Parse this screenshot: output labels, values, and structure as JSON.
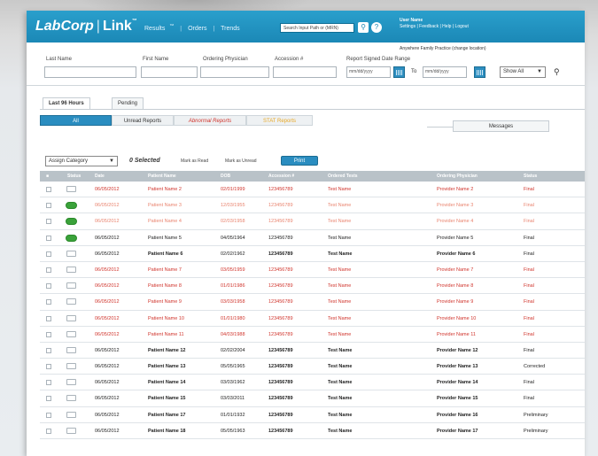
{
  "app": {
    "logo_left": "LabCorp",
    "logo_right": "Link",
    "logo_tm": "™",
    "nav": [
      {
        "label": "Results",
        "sup": "™"
      },
      {
        "label": "Orders"
      },
      {
        "label": "Trends"
      }
    ],
    "search_placeholder": "Search Input Path or (MRN)",
    "user": {
      "name": "User Name",
      "links": "Settings | Feedback | Help | Logout"
    },
    "practice": "Anywhere Family Practice (change location)"
  },
  "filters": {
    "labels": {
      "last_name": "Last Name",
      "first_name": "First Name",
      "ordering_physician": "Ordering Physician",
      "accession": "Accession #",
      "report_date_range": "Report Signed Date Range"
    },
    "date_from": "mm/dd/yyyy",
    "to_label": "To",
    "date_to": "mm/dd/yyyy",
    "show": "Show All"
  },
  "tabs": [
    {
      "label": "Last 96 Hours",
      "active": true
    },
    {
      "label": "Pending",
      "active": false
    }
  ],
  "subtabs": [
    {
      "label": "All"
    },
    {
      "label": "Unread Reports"
    },
    {
      "label": "Abnormal Reports"
    },
    {
      "label": "STAT Reports"
    }
  ],
  "messages_tab": "Messages",
  "actions": {
    "category": "Assign Category",
    "selected": "0 Selected",
    "mark_read": "Mark as Read",
    "mark_unread": "Mark as Unread",
    "print": "Print"
  },
  "table": {
    "headers": [
      "Status",
      "Date",
      "Patient Name",
      "DOB",
      "Accession #",
      "Ordered Tests",
      "Ordering Physician",
      "Status"
    ],
    "rows": [
      {
        "style": "red",
        "icon": "plain",
        "date": "06/05/2012",
        "patient": "Patient Name 2",
        "dob": "02/01/1999",
        "acc": "123456789",
        "test": "Test Name",
        "phys": "Provider Name 2",
        "status": "Final"
      },
      {
        "style": "salmon",
        "icon": "green",
        "date": "06/05/2012",
        "patient": "Patient Name 3",
        "dob": "12/03/1955",
        "acc": "123456789",
        "test": "Test Name",
        "phys": "Provider Name 3",
        "status": "Final"
      },
      {
        "style": "salmon",
        "icon": "green",
        "date": "06/05/2012",
        "patient": "Patient Name 4",
        "dob": "02/03/1958",
        "acc": "123456789",
        "test": "Test Name",
        "phys": "Provider Name 4",
        "status": "Final"
      },
      {
        "style": "black",
        "icon": "green",
        "date": "06/05/2012",
        "patient": "Patient Name 5",
        "dob": "04/05/1964",
        "acc": "123456789",
        "test": "Test Name",
        "phys": "Provider Name 5",
        "status": "Final"
      },
      {
        "style": "black bold",
        "icon": "plain",
        "date": "06/05/2012",
        "patient": "Patient Name 6",
        "dob": "02/02/1962",
        "acc": "123456789",
        "test": "Test Name",
        "phys": "Provider Name 6",
        "status": "Final"
      },
      {
        "style": "red",
        "icon": "plain",
        "date": "06/05/2012",
        "patient": "Patient Name 7",
        "dob": "03/05/1959",
        "acc": "123456789",
        "test": "Test Name",
        "phys": "Provider Name 7",
        "status": "Final"
      },
      {
        "style": "red",
        "icon": "plain",
        "date": "06/05/2012",
        "patient": "Patient Name 8",
        "dob": "01/01/1986",
        "acc": "123456789",
        "test": "Test Name",
        "phys": "Provider Name 8",
        "status": "Final"
      },
      {
        "style": "red",
        "icon": "plain",
        "date": "06/05/2012",
        "patient": "Patient Name 9",
        "dob": "03/03/1958",
        "acc": "123456789",
        "test": "Test Name",
        "phys": "Provider Name 9",
        "status": "Final"
      },
      {
        "style": "red",
        "icon": "plain",
        "date": "06/05/2012",
        "patient": "Patient Name 10",
        "dob": "01/01/1980",
        "acc": "123456789",
        "test": "Test Name",
        "phys": "Provider Name 10",
        "status": "Final"
      },
      {
        "style": "red",
        "icon": "plain",
        "date": "06/05/2012",
        "patient": "Patient Name 11",
        "dob": "04/03/1988",
        "acc": "123456789",
        "test": "Test Name",
        "phys": "Provider Name 11",
        "status": "Final"
      },
      {
        "style": "black bold",
        "icon": "plain",
        "date": "06/05/2012",
        "patient": "Patient Name 12",
        "dob": "02/02/2004",
        "acc": "123456789",
        "test": "Test Name",
        "phys": "Provider Name 12",
        "status": "Final"
      },
      {
        "style": "black bold",
        "icon": "plain",
        "date": "06/05/2012",
        "patient": "Patient Name 13",
        "dob": "05/05/1965",
        "acc": "123456789",
        "test": "Test Name",
        "phys": "Provider Name 13",
        "status": "Corrected"
      },
      {
        "style": "black bold",
        "icon": "plain",
        "date": "06/05/2012",
        "patient": "Patient Name 14",
        "dob": "03/03/1962",
        "acc": "123456789",
        "test": "Test Name",
        "phys": "Provider Name 14",
        "status": "Final"
      },
      {
        "style": "black bold",
        "icon": "plain",
        "date": "06/05/2012",
        "patient": "Patient Name 15",
        "dob": "03/03/2011",
        "acc": "123456789",
        "test": "Test Name",
        "phys": "Provider Name 15",
        "status": "Final"
      },
      {
        "style": "black bold",
        "icon": "plain",
        "date": "06/05/2012",
        "patient": "Patient Name 17",
        "dob": "01/01/1932",
        "acc": "123456789",
        "test": "Test Name",
        "phys": "Provider Name 16",
        "status": "Preliminary"
      },
      {
        "style": "black bold",
        "icon": "plain",
        "date": "06/05/2012",
        "patient": "Patient Name 18",
        "dob": "05/05/1963",
        "acc": "123456789",
        "test": "Test Name",
        "phys": "Provider Name 17",
        "status": "Preliminary"
      }
    ]
  },
  "colors": {
    "brand_blue": "#1b88b6",
    "abnormal_red": "#d0342c",
    "read_salmon": "#e9846f",
    "stat_orange": "#e8a825",
    "unread_green": "#3aa23a"
  }
}
